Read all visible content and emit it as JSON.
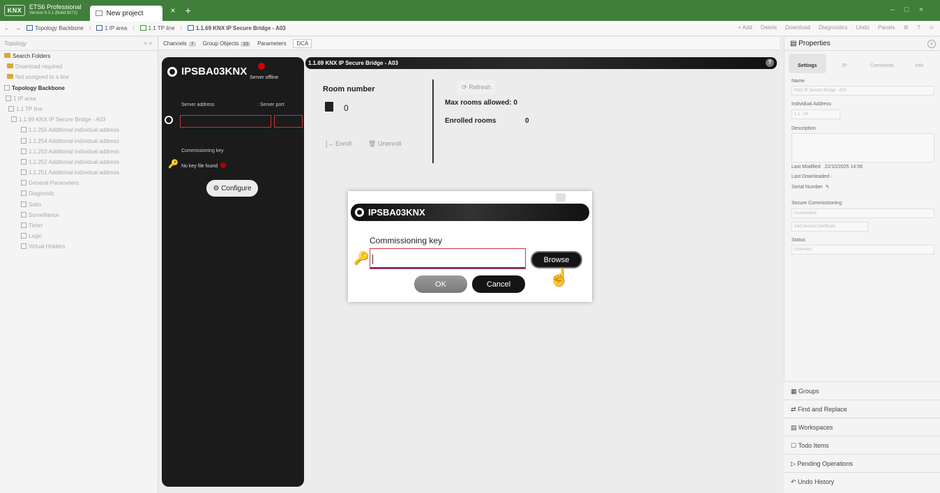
{
  "title_bar": {
    "logo": "KNX",
    "app_name": "ETS6 Professional",
    "app_version": "Version 6.3.1 (Build 8272)",
    "tab_label": "New project"
  },
  "nav": {
    "breadcrumb": [
      "Topology Backbone",
      "1 IP area",
      "1.1 TP line",
      "1.1.69 KNX IP Secure Bridge - A03"
    ],
    "actions": [
      "+ Add",
      "Delete",
      "Download",
      "Diagnostics",
      "Undo",
      "Panels"
    ]
  },
  "left_panel": {
    "header": "Topology",
    "tree": [
      {
        "label": "Search Folders",
        "style": "normal"
      },
      {
        "label": "Download required",
        "style": "dim"
      },
      {
        "label": "Not assigned to a line",
        "style": "dim"
      },
      {
        "label": "Topology Backbone",
        "style": "bold"
      },
      {
        "label": "1 IP area",
        "style": "dim"
      },
      {
        "label": "1.1 TP line",
        "style": "dim"
      },
      {
        "label": "1.1.69 KNX IP Secure Bridge - A03",
        "style": "dim"
      },
      {
        "label": "1.1.255 Additional individual address",
        "style": "dim"
      },
      {
        "label": "1.1.254 Additional individual address",
        "style": "dim"
      },
      {
        "label": "1.1.253 Additional individual address",
        "style": "dim"
      },
      {
        "label": "1.1.252 Additional individual address",
        "style": "dim"
      },
      {
        "label": "1.1.251 Additional individual address",
        "style": "dim"
      },
      {
        "label": "General Parameters",
        "style": "dim"
      },
      {
        "label": "Diagnostic",
        "style": "dim"
      },
      {
        "label": "Salto",
        "style": "dim"
      },
      {
        "label": "Surveillance",
        "style": "dim"
      },
      {
        "label": "Timer",
        "style": "dim"
      },
      {
        "label": "Logic",
        "style": "dim"
      },
      {
        "label": "Virtual Holders",
        "style": "dim"
      }
    ]
  },
  "top_tabs": {
    "channels": "Channels",
    "channels_count": "7",
    "group_objects": "Group Objects",
    "group_objects_count": "10",
    "parameters": "Parameters",
    "dca": "DCA"
  },
  "device_panel": {
    "logo": "IPSBA03KNX",
    "server_status": "Server offline",
    "server_address_label": "Server address",
    "server_port_label": ": Server port",
    "commissioning_key_label": "Commissioning key",
    "no_key_text": "No key file found",
    "configure_label": "Configure"
  },
  "main": {
    "header": "1.1.69 KNX IP Secure Bridge - A03",
    "room_number_label": "Room number",
    "room_number_value": "0",
    "enroll_label": "Enroll",
    "unenroll_label": "Unenroll",
    "refresh_label": "Refresh",
    "max_rooms_label": "Max rooms allowed: 0",
    "enrolled_rooms_label": "Enrolled rooms",
    "enrolled_rooms_value": "0"
  },
  "modal": {
    "header": "IPSBA03KNX",
    "label": "Commissioning key",
    "input_value": "",
    "browse_label": "Browse",
    "ok_label": "OK",
    "cancel_label": "Cancel"
  },
  "properties": {
    "title": "Properties",
    "tabs": [
      "Settings",
      "IP",
      "Comments",
      "Info"
    ],
    "name_label": "Name",
    "name_value": "KNX IP Secure Bridge - A03",
    "ia_label": "Individual Address",
    "ia_value": "1.1 . 69",
    "description_label": "Description",
    "last_modified_label": "Last Modified",
    "last_modified_value": "22/10/2025 14:56",
    "last_downloaded_label": "Last Downloaded",
    "last_downloaded_value": "-",
    "serial_label": "Serial Number",
    "secure_label": "Secure Commissioning",
    "secure_value": "Deactivated",
    "add_cert_label": "Add Device Certificate",
    "status_label": "Status",
    "status_value": "Unknown"
  },
  "bottom_panels": [
    "Groups",
    "Find and Replace",
    "Workspaces",
    "Todo Items",
    "Pending Operations",
    "Undo History"
  ]
}
